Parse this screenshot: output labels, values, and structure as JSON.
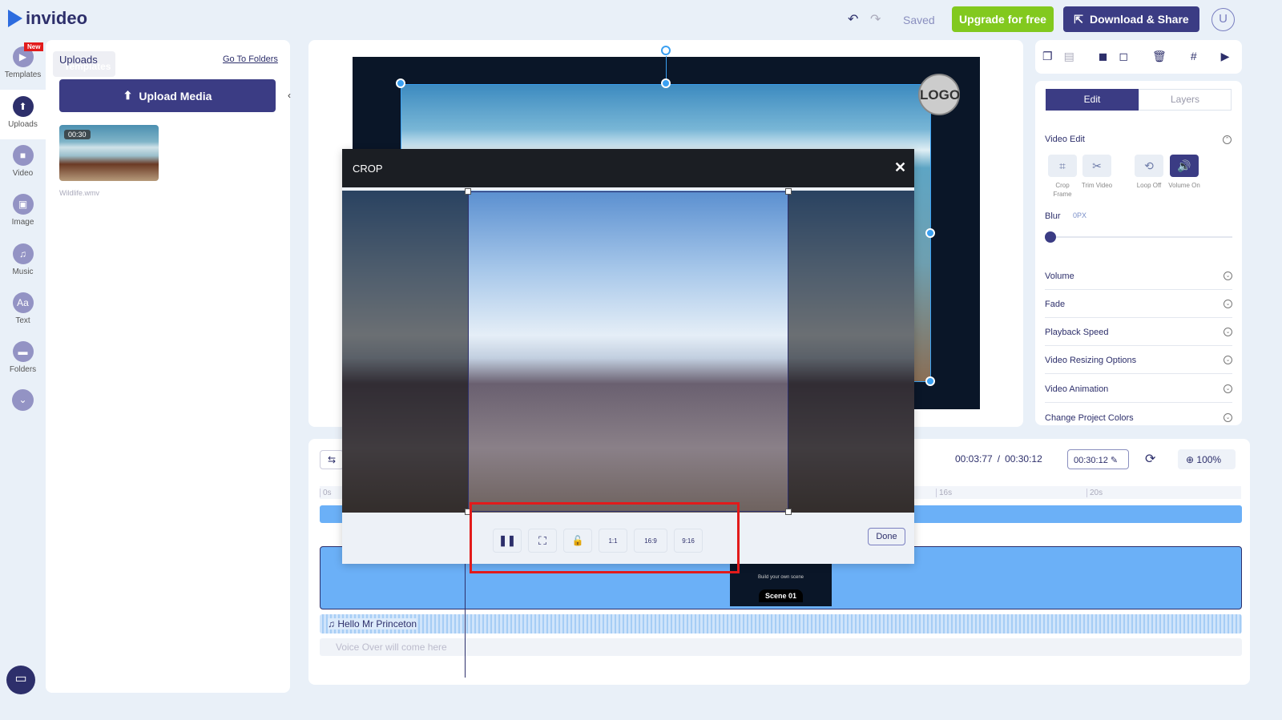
{
  "app": {
    "name": "invideo"
  },
  "header": {
    "status": "Saved",
    "upgrade_label": "Upgrade for free",
    "download_label": "Download & Share",
    "avatar": "U"
  },
  "rail": [
    {
      "label": "Templates",
      "badge": "New",
      "icon": "templates-icon"
    },
    {
      "label": "Uploads",
      "icon": "upload-icon"
    },
    {
      "label": "Video",
      "icon": "video-icon"
    },
    {
      "label": "Image",
      "icon": "image-icon"
    },
    {
      "label": "Music",
      "icon": "music-icon"
    },
    {
      "label": "Text",
      "icon": "text-icon",
      "glyph": "Aa"
    },
    {
      "label": "Folders",
      "icon": "folder-icon"
    }
  ],
  "uploads": {
    "title": "Uploads",
    "tooltip": "Templates",
    "go_to_folders": "Go To Folders",
    "upload_button": "Upload Media",
    "media": [
      {
        "duration": "00:30",
        "name": "Wildlife.wmv"
      }
    ]
  },
  "canvas": {
    "logo": "LOGO"
  },
  "crop": {
    "title": "CROP",
    "done": "Done",
    "buttons": [
      "pause",
      "fit",
      "lock",
      "1:1",
      "16:9",
      "9:16"
    ]
  },
  "right": {
    "tabs": [
      "Edit",
      "Layers"
    ],
    "section": "Video Edit",
    "tools": [
      {
        "label": "Crop Frame"
      },
      {
        "label": "Trim Video"
      },
      {
        "label": "Loop Off"
      },
      {
        "label": "Volume On"
      }
    ],
    "blur_label": "Blur",
    "blur_value": "0PX",
    "blur_level": 0,
    "sections": [
      "Volume",
      "Fade",
      "Playback Speed",
      "Video Resizing Options",
      "Video Animation",
      "Change Project Colors"
    ]
  },
  "timeline": {
    "current": "00:03:77",
    "separator": "/",
    "total": "00:30:12",
    "duration_field": "00:30:12",
    "zoom": "100%",
    "ticks": [
      "0s",
      "16s",
      "20s"
    ],
    "scene_caption": "Build your own scene",
    "scene_label": "Scene 01",
    "audio_track": "Hello Mr Princeton",
    "voice_over": "Voice Over will come here"
  }
}
